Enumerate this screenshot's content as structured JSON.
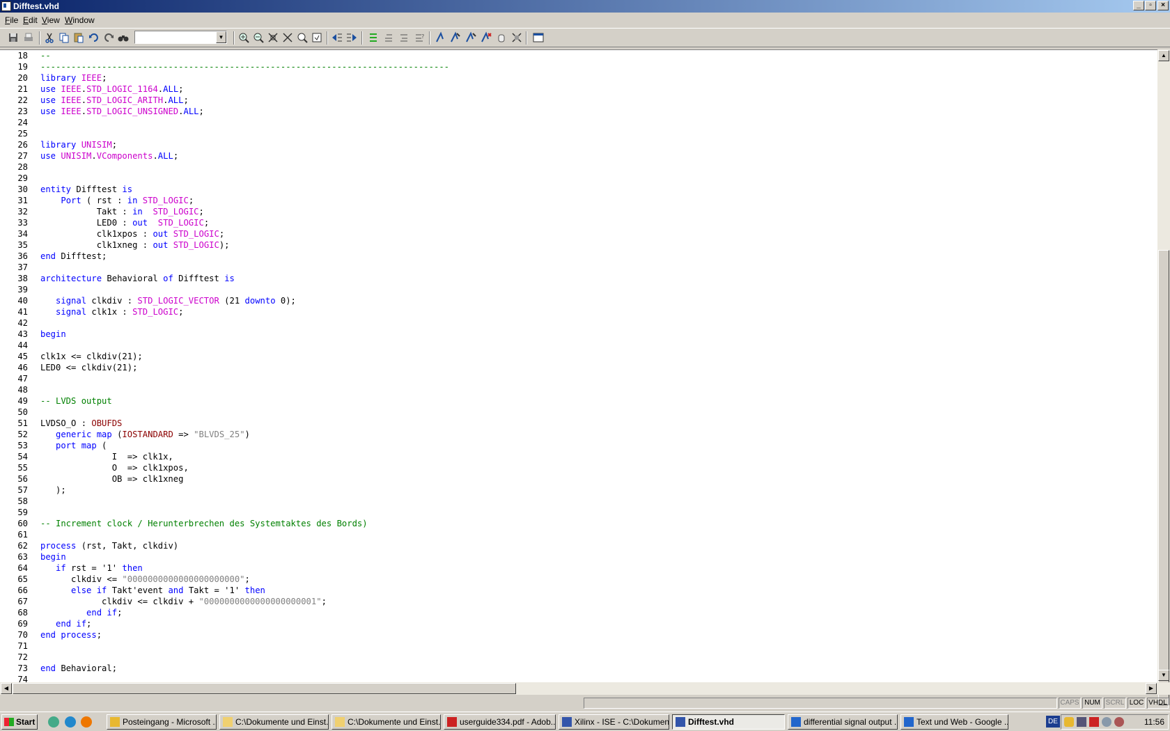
{
  "window": {
    "title": "Difftest.vhd"
  },
  "menu": [
    {
      "label_u": "F",
      "label_rest": "ile"
    },
    {
      "label_u": "E",
      "label_rest": "dit"
    },
    {
      "label_u": "V",
      "label_rest": "iew"
    },
    {
      "label_u": "W",
      "label_rest": "indow"
    }
  ],
  "toolbar": {
    "search_value": ""
  },
  "editor": {
    "lines": [
      {
        "n": "18",
        "html": "<span class=\"c\">--</span>"
      },
      {
        "n": "19",
        "html": "<span class=\"c\">--------------------------------------------------------------------------------</span>"
      },
      {
        "n": "20",
        "html": "<span class=\"k\">library</span> <span class=\"t\">IEEE</span>;"
      },
      {
        "n": "21",
        "html": "<span class=\"k\">use</span> <span class=\"t\">IEEE</span>.<span class=\"t\">STD_LOGIC_1164</span>.<span class=\"k\">ALL</span>;"
      },
      {
        "n": "22",
        "html": "<span class=\"k\">use</span> <span class=\"t\">IEEE</span>.<span class=\"t\">STD_LOGIC_ARITH</span>.<span class=\"k\">ALL</span>;"
      },
      {
        "n": "23",
        "html": "<span class=\"k\">use</span> <span class=\"t\">IEEE</span>.<span class=\"t\">STD_LOGIC_UNSIGNED</span>.<span class=\"k\">ALL</span>;"
      },
      {
        "n": "24",
        "html": ""
      },
      {
        "n": "25",
        "html": ""
      },
      {
        "n": "26",
        "html": "<span class=\"k\">library</span> <span class=\"t\">UNISIM</span>;"
      },
      {
        "n": "27",
        "html": "<span class=\"k\">use</span> <span class=\"t\">UNISIM</span>.<span class=\"t\">VComponents</span>.<span class=\"k\">ALL</span>;"
      },
      {
        "n": "28",
        "html": ""
      },
      {
        "n": "29",
        "html": ""
      },
      {
        "n": "30",
        "html": "<span class=\"k\">entity</span> Difftest <span class=\"k\">is</span>"
      },
      {
        "n": "31",
        "html": "    <span class=\"k\">Port</span> ( rst : <span class=\"k\">in</span> <span class=\"t\">STD_LOGIC</span>;"
      },
      {
        "n": "32",
        "html": "           Takt : <span class=\"k\">in</span>  <span class=\"t\">STD_LOGIC</span>;"
      },
      {
        "n": "33",
        "html": "           LED0 : <span class=\"k\">out</span>  <span class=\"t\">STD_LOGIC</span>;"
      },
      {
        "n": "34",
        "html": "           clk1xpos : <span class=\"k\">out</span> <span class=\"t\">STD_LOGIC</span>;"
      },
      {
        "n": "35",
        "html": "           clk1xneg : <span class=\"k\">out</span> <span class=\"t\">STD_LOGIC</span>);"
      },
      {
        "n": "36",
        "html": "<span class=\"k\">end</span> Difftest;"
      },
      {
        "n": "37",
        "html": ""
      },
      {
        "n": "38",
        "html": "<span class=\"k\">architecture</span> Behavioral <span class=\"k\">of</span> Difftest <span class=\"k\">is</span>"
      },
      {
        "n": "39",
        "html": ""
      },
      {
        "n": "40",
        "html": "   <span class=\"k\">signal</span> clkdiv : <span class=\"t\">STD_LOGIC_VECTOR</span> (21 <span class=\"k\">downto</span> 0);"
      },
      {
        "n": "41",
        "html": "   <span class=\"k\">signal</span> clk1x : <span class=\"t\">STD_LOGIC</span>;"
      },
      {
        "n": "42",
        "html": ""
      },
      {
        "n": "43",
        "html": "<span class=\"k\">begin</span>"
      },
      {
        "n": "44",
        "html": ""
      },
      {
        "n": "45",
        "html": "clk1x &lt;= clkdiv(21);"
      },
      {
        "n": "46",
        "html": "LED0 &lt;= clkdiv(21);"
      },
      {
        "n": "47",
        "html": ""
      },
      {
        "n": "48",
        "html": ""
      },
      {
        "n": "49",
        "html": "<span class=\"c\">-- LVDS output</span>"
      },
      {
        "n": "50",
        "html": ""
      },
      {
        "n": "51",
        "html": "LVDSO_O : <span class=\"r\">OBUFDS</span>"
      },
      {
        "n": "52",
        "html": "   <span class=\"k\">generic map</span> (<span class=\"r\">IOSTANDARD</span> =&gt; <span class=\"s\">\"BLVDS_25\"</span>)"
      },
      {
        "n": "53",
        "html": "   <span class=\"k\">port map</span> ("
      },
      {
        "n": "54",
        "html": "              I  =&gt; clk1x,"
      },
      {
        "n": "55",
        "html": "              O  =&gt; clk1xpos,"
      },
      {
        "n": "56",
        "html": "              OB =&gt; clk1xneg"
      },
      {
        "n": "57",
        "html": "   );"
      },
      {
        "n": "58",
        "html": ""
      },
      {
        "n": "59",
        "html": ""
      },
      {
        "n": "60",
        "html": "<span class=\"c\">-- Increment clock / Herunterbrechen des Systemtaktes des Bords)</span>"
      },
      {
        "n": "61",
        "html": ""
      },
      {
        "n": "62",
        "html": "<span class=\"k\">process</span> (rst, Takt, clkdiv)"
      },
      {
        "n": "63",
        "html": "<span class=\"k\">begin</span>"
      },
      {
        "n": "64",
        "html": "   <span class=\"k\">if</span> rst = '1' <span class=\"k\">then</span>"
      },
      {
        "n": "65",
        "html": "      clkdiv &lt;= <span class=\"s\">\"0000000000000000000000\"</span>;"
      },
      {
        "n": "66",
        "html": "      <span class=\"k\">else if</span> Takt'event <span class=\"k\">and</span> Takt = '1' <span class=\"k\">then</span>"
      },
      {
        "n": "67",
        "html": "            clkdiv &lt;= clkdiv + <span class=\"s\">\"0000000000000000000001\"</span>;"
      },
      {
        "n": "68",
        "html": "         <span class=\"k\">end if</span>;"
      },
      {
        "n": "69",
        "html": "   <span class=\"k\">end if</span>;"
      },
      {
        "n": "70",
        "html": "<span class=\"k\">end process</span>;"
      },
      {
        "n": "71",
        "html": ""
      },
      {
        "n": "72",
        "html": ""
      },
      {
        "n": "73",
        "html": "<span class=\"k\">end</span> Behavioral;"
      },
      {
        "n": "74",
        "html": ""
      }
    ]
  },
  "status": {
    "caps": "CAPS",
    "num": "NUM",
    "scrl": "SCRL",
    "loc": "LOC",
    "lang": "VHDL"
  },
  "taskbar": {
    "start": "Start",
    "tasks": [
      {
        "label": "Posteingang - Microsoft ...",
        "color": "#e8b830"
      },
      {
        "label": "C:\\Dokumente und Einst...",
        "color": "#f0d070"
      },
      {
        "label": "C:\\Dokumente und Einst...",
        "color": "#f0d070"
      },
      {
        "label": "userguide334.pdf - Adob...",
        "color": "#cc2222"
      },
      {
        "label": "Xilinx - ISE - C:\\Dokumen...",
        "color": "#3355aa"
      },
      {
        "label": "Difftest.vhd",
        "color": "#3355aa"
      },
      {
        "label": "differential signal output ...",
        "color": "#2266cc"
      },
      {
        "label": "Text und Web - Google ...",
        "color": "#2266cc"
      }
    ],
    "language": "DE",
    "clock": "11:56"
  }
}
